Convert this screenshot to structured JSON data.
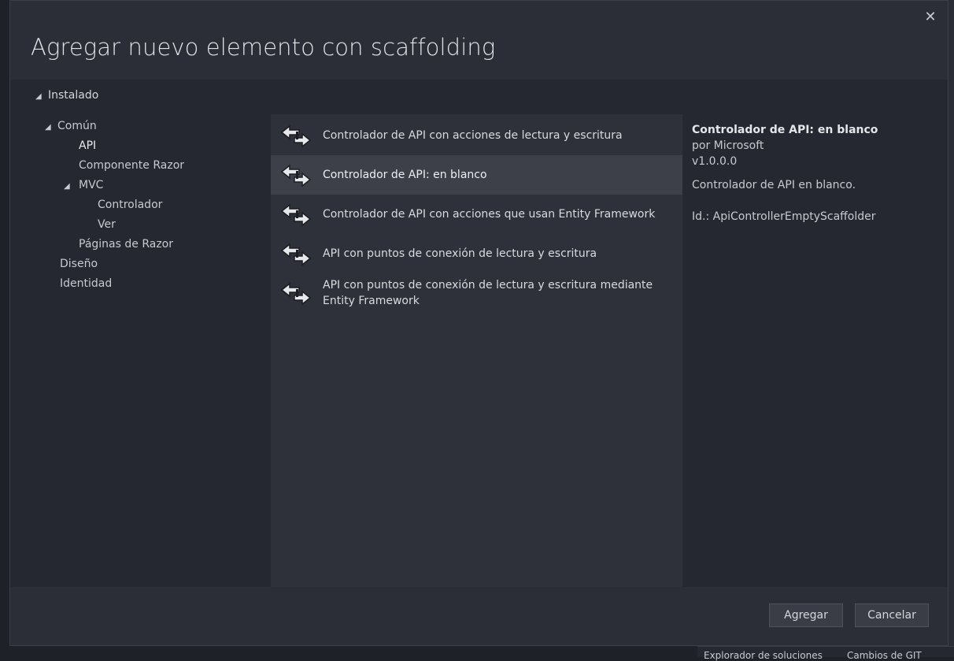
{
  "dialog": {
    "title": "Agregar nuevo elemento con scaffolding",
    "close_glyph": "✕"
  },
  "tree": {
    "root_label": "Instalado",
    "items": [
      {
        "label": "Común",
        "expanded": true
      },
      {
        "label": "API",
        "selected": true
      },
      {
        "label": "Componente Razor"
      },
      {
        "label": "MVC",
        "expanded": true
      },
      {
        "label": "Controlador"
      },
      {
        "label": "Ver"
      },
      {
        "label": "Páginas de Razor"
      },
      {
        "label": "Diseño"
      },
      {
        "label": "Identidad"
      }
    ]
  },
  "templates": [
    {
      "label": "Controlador de API con acciones de lectura y escritura",
      "icon": "scaffold-icon"
    },
    {
      "label": "Controlador de API: en blanco",
      "icon": "scaffold-icon",
      "selected": true
    },
    {
      "label": "Controlador de API con acciones que usan Entity Framework",
      "icon": "scaffold-icon"
    },
    {
      "label": "API con puntos de conexión de lectura y escritura",
      "icon": "scaffold-icon"
    },
    {
      "label": "API con puntos de conexión de lectura y escritura mediante Entity Framework",
      "icon": "scaffold-icon"
    }
  ],
  "details": {
    "title": "Controlador de API: en blanco",
    "author": "por Microsoft",
    "version": "v1.0.0.0",
    "description": "Controlador de API en blanco.",
    "id": "Id.: ApiControllerEmptyScaffolder"
  },
  "buttons": {
    "add": "Agregar",
    "cancel": "Cancelar"
  },
  "background": {
    "bottom_tab_1": "Explorador de soluciones",
    "bottom_tab_2": "Cambios de GIT"
  },
  "colors": {
    "dialog_bg": "#2b2e36",
    "list_bg": "#2e3139",
    "selected_row": "#3d4049"
  }
}
